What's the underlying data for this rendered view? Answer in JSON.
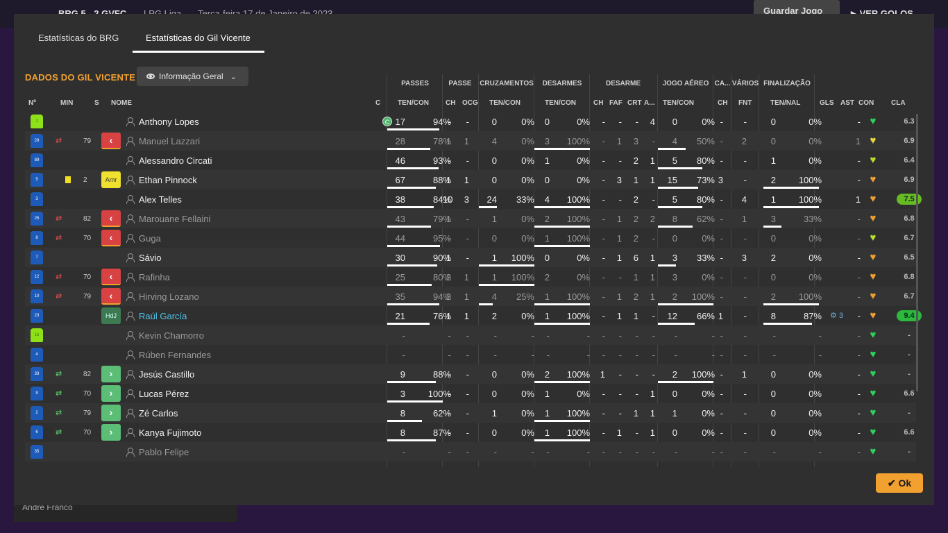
{
  "background": {
    "score": "BRG  5 - 2  GVFC",
    "league": "LPG Liga",
    "date": "Terça-feira 17 de Janeiro de 2023",
    "save_label": "Guardar Jogo",
    "goals_label": "VER GOLOS",
    "sidebar_player": "André Franco"
  },
  "tabs": [
    "Estatísticas do BRG",
    "Estatísticas do Gil Vicente"
  ],
  "team_title": "DADOS DO GIL VICENTE",
  "view_dropdown": "Informação Geral",
  "groups": [
    "PASSES",
    "PASSE",
    "CRUZAMENTOS",
    "DESARMES",
    "DESARME",
    "JOGO AÉREO",
    "CA...",
    "VÁRIOS",
    "FINALIZAÇÃO"
  ],
  "headers": [
    "Nº",
    "MIN",
    "S",
    "NOME",
    "C",
    "TEN/CON",
    "CH",
    "OCG",
    "TEN/CON",
    "TEN/CON",
    "CH",
    "FAF",
    "CRT",
    "A...",
    "TEN/CON",
    "CH",
    "FNT",
    "TEN/NAL",
    "GLS",
    "AST",
    "CON",
    "CLA"
  ],
  "ok_label": "Ok",
  "colors": {
    "accent": "#f2a130",
    "sub_out": "#d94242",
    "sub_in": "#5bbd76",
    "highlight_name": "#4fc3e8"
  },
  "players": [
    {
      "no": "1",
      "min": "",
      "swap": "",
      "status": "",
      "name": "Anthony Lopes",
      "captain": "C",
      "pass": [
        "17",
        "94%"
      ],
      "passe": [
        "-",
        "-"
      ],
      "cruz": [
        "0",
        "0%"
      ],
      "des": [
        "0",
        "0%"
      ],
      "desarme": [
        "-",
        "-",
        "-",
        "4"
      ],
      "aer": [
        "0",
        "0%"
      ],
      "ca": "-",
      "fnt": "-",
      "fin": [
        "0",
        "0%"
      ],
      "gls": "",
      "ast": "-",
      "con": "green",
      "cla": "6.3",
      "dim": false
    },
    {
      "no": "29",
      "min": "79",
      "swap": "out",
      "status": "out",
      "name": "Manuel Lazzari",
      "captain": "",
      "pass": [
        "28",
        "78%"
      ],
      "passe": [
        "1",
        "1"
      ],
      "cruz": [
        "4",
        "0%"
      ],
      "des": [
        "3",
        "100%"
      ],
      "desarme": [
        "-",
        "1",
        "3",
        "-"
      ],
      "aer": [
        "4",
        "50%"
      ],
      "ca": "-",
      "fnt": "2",
      "fin": [
        "0",
        "0%"
      ],
      "gls": "",
      "ast": "1",
      "con": "yellow",
      "cla": "6.9",
      "dim": true
    },
    {
      "no": "89",
      "min": "",
      "swap": "",
      "status": "",
      "name": "Alessandro Circati",
      "captain": "",
      "pass": [
        "46",
        "93%"
      ],
      "passe": [
        "-",
        "-"
      ],
      "cruz": [
        "0",
        "0%"
      ],
      "des": [
        "1",
        "0%"
      ],
      "desarme": [
        "-",
        "-",
        "2",
        "1"
      ],
      "aer": [
        "5",
        "80%"
      ],
      "ca": "-",
      "fnt": "-",
      "fin": [
        "1",
        "0%"
      ],
      "gls": "",
      "ast": "-",
      "con": "lime",
      "cla": "6.4",
      "dim": false
    },
    {
      "no": "5",
      "min": "2",
      "swap": "card",
      "status": "amr",
      "name": "Ethan Pinnock",
      "captain": "",
      "pass": [
        "67",
        "88%"
      ],
      "passe": [
        "1",
        "1"
      ],
      "cruz": [
        "0",
        "0%"
      ],
      "des": [
        "0",
        "0%"
      ],
      "desarme": [
        "-",
        "3",
        "1",
        "1"
      ],
      "aer": [
        "15",
        "73%"
      ],
      "ca": "3",
      "fnt": "-",
      "fin": [
        "2",
        "100%"
      ],
      "gls": "",
      "ast": "-",
      "con": "orange",
      "cla": "6.9",
      "dim": false
    },
    {
      "no": "3",
      "min": "",
      "swap": "",
      "status": "",
      "name": "Alex Telles",
      "captain": "",
      "pass": [
        "38",
        "84%"
      ],
      "passe": [
        "10",
        "3"
      ],
      "cruz": [
        "24",
        "33%"
      ],
      "des": [
        "4",
        "100%"
      ],
      "desarme": [
        "-",
        "-",
        "2",
        "-"
      ],
      "aer": [
        "5",
        "80%"
      ],
      "ca": "-",
      "fnt": "4",
      "fin": [
        "1",
        "100%"
      ],
      "gls": "",
      "ast": "1",
      "con": "orange",
      "cla": "7.5",
      "dim": false
    },
    {
      "no": "25",
      "min": "82",
      "swap": "out",
      "status": "out",
      "name": "Marouane Fellaini",
      "captain": "",
      "pass": [
        "43",
        "79%"
      ],
      "passe": [
        "1",
        "-"
      ],
      "cruz": [
        "1",
        "0%"
      ],
      "des": [
        "2",
        "100%"
      ],
      "desarme": [
        "-",
        "1",
        "2",
        "2"
      ],
      "aer": [
        "8",
        "62%"
      ],
      "ca": "-",
      "fnt": "1",
      "fin": [
        "3",
        "33%"
      ],
      "gls": "",
      "ast": "-",
      "con": "orange",
      "cla": "6.8",
      "dim": true
    },
    {
      "no": "8",
      "min": "70",
      "swap": "out",
      "status": "out",
      "name": "Guga",
      "captain": "",
      "pass": [
        "44",
        "95%"
      ],
      "passe": [
        "-",
        "-"
      ],
      "cruz": [
        "0",
        "0%"
      ],
      "des": [
        "1",
        "100%"
      ],
      "desarme": [
        "-",
        "1",
        "2",
        "-"
      ],
      "aer": [
        "0",
        "0%"
      ],
      "ca": "-",
      "fnt": "-",
      "fin": [
        "0",
        "0%"
      ],
      "gls": "",
      "ast": "-",
      "con": "lime",
      "cla": "6.7",
      "dim": true
    },
    {
      "no": "7",
      "min": "",
      "swap": "",
      "status": "",
      "name": "Sávio",
      "captain": "",
      "pass": [
        "30",
        "90%"
      ],
      "passe": [
        "1",
        "-"
      ],
      "cruz": [
        "1",
        "100%"
      ],
      "des": [
        "0",
        "0%"
      ],
      "desarme": [
        "-",
        "1",
        "6",
        "1"
      ],
      "aer": [
        "3",
        "33%"
      ],
      "ca": "-",
      "fnt": "3",
      "fin": [
        "2",
        "0%"
      ],
      "gls": "",
      "ast": "-",
      "con": "orange",
      "cla": "6.5",
      "dim": false
    },
    {
      "no": "12",
      "min": "70",
      "swap": "out",
      "status": "out",
      "name": "Rafinha",
      "captain": "",
      "pass": [
        "25",
        "80%"
      ],
      "passe": [
        "2",
        "1"
      ],
      "cruz": [
        "1",
        "100%"
      ],
      "des": [
        "2",
        "0%"
      ],
      "desarme": [
        "-",
        "-",
        "1",
        "1"
      ],
      "aer": [
        "3",
        "0%"
      ],
      "ca": "-",
      "fnt": "-",
      "fin": [
        "0",
        "0%"
      ],
      "gls": "",
      "ast": "-",
      "con": "orange",
      "cla": "6.8",
      "dim": true
    },
    {
      "no": "10",
      "min": "79",
      "swap": "out",
      "status": "out",
      "name": "Hirving Lozano",
      "captain": "",
      "pass": [
        "35",
        "94%"
      ],
      "passe": [
        "2",
        "1"
      ],
      "cruz": [
        "4",
        "25%"
      ],
      "des": [
        "1",
        "100%"
      ],
      "desarme": [
        "-",
        "1",
        "2",
        "1"
      ],
      "aer": [
        "2",
        "100%"
      ],
      "ca": "-",
      "fnt": "-",
      "fin": [
        "2",
        "100%"
      ],
      "gls": "",
      "ast": "-",
      "con": "orange",
      "cla": "6.7",
      "dim": true
    },
    {
      "no": "23",
      "min": "",
      "swap": "",
      "status": "hdl",
      "name": "Raúl García",
      "captain": "",
      "pass": [
        "21",
        "76%"
      ],
      "passe": [
        "1",
        "1"
      ],
      "cruz": [
        "2",
        "0%"
      ],
      "des": [
        "1",
        "100%"
      ],
      "desarme": [
        "-",
        "1",
        "1",
        "-"
      ],
      "aer": [
        "12",
        "66%"
      ],
      "ca": "1",
      "fnt": "-",
      "fin": [
        "8",
        "87%"
      ],
      "gls": "3",
      "ast": "-",
      "con": "orange",
      "cla": "9.4",
      "dim": false,
      "highlight": true
    },
    {
      "no": "16",
      "min": "",
      "swap": "",
      "status": "",
      "name": "Kevin Chamorro",
      "captain": "",
      "pass": [
        "-",
        "-"
      ],
      "passe": [
        "-",
        "-"
      ],
      "cruz": [
        "-",
        "-"
      ],
      "des": [
        "-",
        "-"
      ],
      "desarme": [
        "-",
        "-",
        "-",
        "-"
      ],
      "aer": [
        "-",
        "-"
      ],
      "ca": "-",
      "fnt": "-",
      "fin": [
        "-",
        "-"
      ],
      "gls": "",
      "ast": "-",
      "con": "green",
      "cla": "-",
      "dim": true
    },
    {
      "no": "4",
      "min": "",
      "swap": "",
      "status": "",
      "name": "Rúben Fernandes",
      "captain": "",
      "pass": [
        "-",
        "-"
      ],
      "passe": [
        "-",
        "-"
      ],
      "cruz": [
        "-",
        "-"
      ],
      "des": [
        "-",
        "-"
      ],
      "desarme": [
        "-",
        "-",
        "-",
        "-"
      ],
      "aer": [
        "-",
        "-"
      ],
      "ca": "-",
      "fnt": "-",
      "fin": [
        "-",
        "-"
      ],
      "gls": "",
      "ast": "-",
      "con": "green",
      "cla": "-",
      "dim": true
    },
    {
      "no": "33",
      "min": "82",
      "swap": "in",
      "status": "in",
      "name": "Jesús Castillo",
      "captain": "",
      "pass": [
        "9",
        "88%"
      ],
      "passe": [
        "-",
        "-"
      ],
      "cruz": [
        "0",
        "0%"
      ],
      "des": [
        "2",
        "100%"
      ],
      "desarme": [
        "1",
        "-",
        "-",
        "-"
      ],
      "aer": [
        "2",
        "100%"
      ],
      "ca": "-",
      "fnt": "1",
      "fin": [
        "0",
        "0%"
      ],
      "gls": "",
      "ast": "-",
      "con": "green",
      "cla": "-",
      "dim": false
    },
    {
      "no": "9",
      "min": "70",
      "swap": "in",
      "status": "in",
      "name": "Lucas Pérez",
      "captain": "",
      "pass": [
        "3",
        "100%"
      ],
      "passe": [
        "-",
        "-"
      ],
      "cruz": [
        "0",
        "0%"
      ],
      "des": [
        "1",
        "0%"
      ],
      "desarme": [
        "-",
        "-",
        "-",
        "1"
      ],
      "aer": [
        "0",
        "0%"
      ],
      "ca": "-",
      "fnt": "-",
      "fin": [
        "0",
        "0%"
      ],
      "gls": "",
      "ast": "-",
      "con": "green",
      "cla": "6.6",
      "dim": false
    },
    {
      "no": "2",
      "min": "79",
      "swap": "in",
      "status": "in",
      "name": "Zé Carlos",
      "captain": "",
      "pass": [
        "8",
        "62%"
      ],
      "passe": [
        "-",
        "-"
      ],
      "cruz": [
        "1",
        "0%"
      ],
      "des": [
        "1",
        "100%"
      ],
      "desarme": [
        "-",
        "-",
        "1",
        "1"
      ],
      "aer": [
        "1",
        "0%"
      ],
      "ca": "-",
      "fnt": "-",
      "fin": [
        "0",
        "0%"
      ],
      "gls": "",
      "ast": "-",
      "con": "green",
      "cla": "-",
      "dim": false
    },
    {
      "no": "6",
      "min": "70",
      "swap": "in",
      "status": "in",
      "name": "Kanya Fujimoto",
      "captain": "",
      "pass": [
        "8",
        "87%"
      ],
      "passe": [
        "-",
        "-"
      ],
      "cruz": [
        "0",
        "0%"
      ],
      "des": [
        "1",
        "100%"
      ],
      "desarme": [
        "-",
        "1",
        "-",
        "1"
      ],
      "aer": [
        "0",
        "0%"
      ],
      "ca": "-",
      "fnt": "-",
      "fin": [
        "0",
        "0%"
      ],
      "gls": "",
      "ast": "-",
      "con": "green",
      "cla": "6.6",
      "dim": false
    },
    {
      "no": "35",
      "min": "",
      "swap": "",
      "status": "",
      "name": "Pablo Felipe",
      "captain": "",
      "pass": [
        "-",
        "-"
      ],
      "passe": [
        "-",
        "-"
      ],
      "cruz": [
        "-",
        "-"
      ],
      "des": [
        "-",
        "-"
      ],
      "desarme": [
        "-",
        "-",
        "-",
        "-"
      ],
      "aer": [
        "-",
        "-"
      ],
      "ca": "-",
      "fnt": "-",
      "fin": [
        "-",
        "-"
      ],
      "gls": "",
      "ast": "-",
      "con": "green",
      "cla": "-",
      "dim": true
    }
  ]
}
